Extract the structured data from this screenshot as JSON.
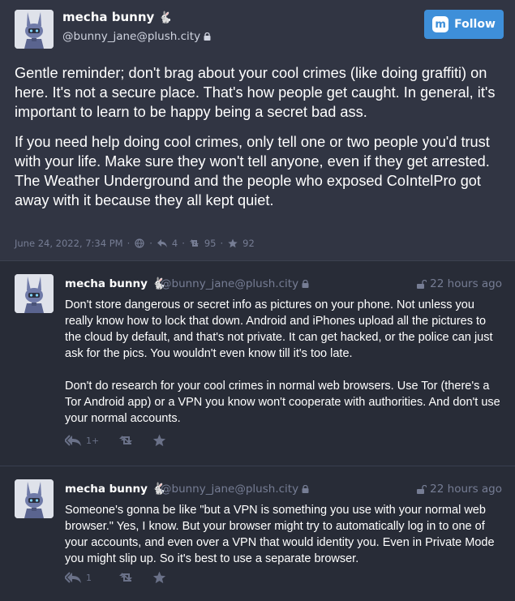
{
  "focus": {
    "display_name": "mecha bunny",
    "name_emoji": "🐇",
    "handle": "@bunny_jane@plush.city",
    "follow_label": "Follow",
    "paragraphs": [
      "Gentle reminder; don't brag about your cool crimes (like doing graffiti) on here. It's not a secure place. That's how people get caught. In general, it's important to learn to be happy being a secret bad ass.",
      "If you need help doing cool crimes, only tell one or two people you'd trust with your life. Make sure they won't tell anyone, even if they get arrested. The Weather Underground and the people who exposed CoIntelPro got away with it because they all kept quiet."
    ],
    "timestamp": "June 24, 2022, 7:34 PM",
    "reply_count": "4",
    "boost_count": "95",
    "favourite_count": "92"
  },
  "replies": [
    {
      "display_name": "mecha bunny",
      "name_emoji": "🐇",
      "handle": "@bunny_jane@plush.city",
      "time": "22 hours ago",
      "paragraphs": [
        "Don't store dangerous or secret info as pictures on your phone. Not unless you really know how to lock that down. Android and iPhones upload all the pictures to the cloud by default, and that's not private. It can get hacked, or the police can just ask for the pics. You wouldn't even know till it's too late.",
        "Don't do research for your cool crimes in normal web browsers. Use Tor (there's a Tor Android app) or a VPN you know won't cooperate with authorities. And don't use your normal accounts."
      ],
      "reply_count": "1+"
    },
    {
      "display_name": "mecha bunny",
      "name_emoji": "🐇",
      "handle": "@bunny_jane@plush.city",
      "time": "22 hours ago",
      "paragraphs": [
        "Someone's gonna be like \"but a VPN is something you use with your normal web browser.\" Yes, I know. But your browser might try to automatically log in to one of your accounts, and even over a VPN that would identity you. Even in Private Mode you might slip up. So it's best to use a separate browser."
      ],
      "reply_count": "1"
    }
  ],
  "icons": {
    "avatar": "robot-bunny-avatar",
    "visibility": "globe-icon",
    "reply": "reply-icon",
    "boost": "boost-icon",
    "favourite": "star-icon",
    "lock": "lock-icon",
    "unlock": "unlock-icon"
  },
  "colors": {
    "accent": "#3e8fd9",
    "background": "#282c37",
    "focus_background": "#313543",
    "muted_text": "#767d94"
  }
}
